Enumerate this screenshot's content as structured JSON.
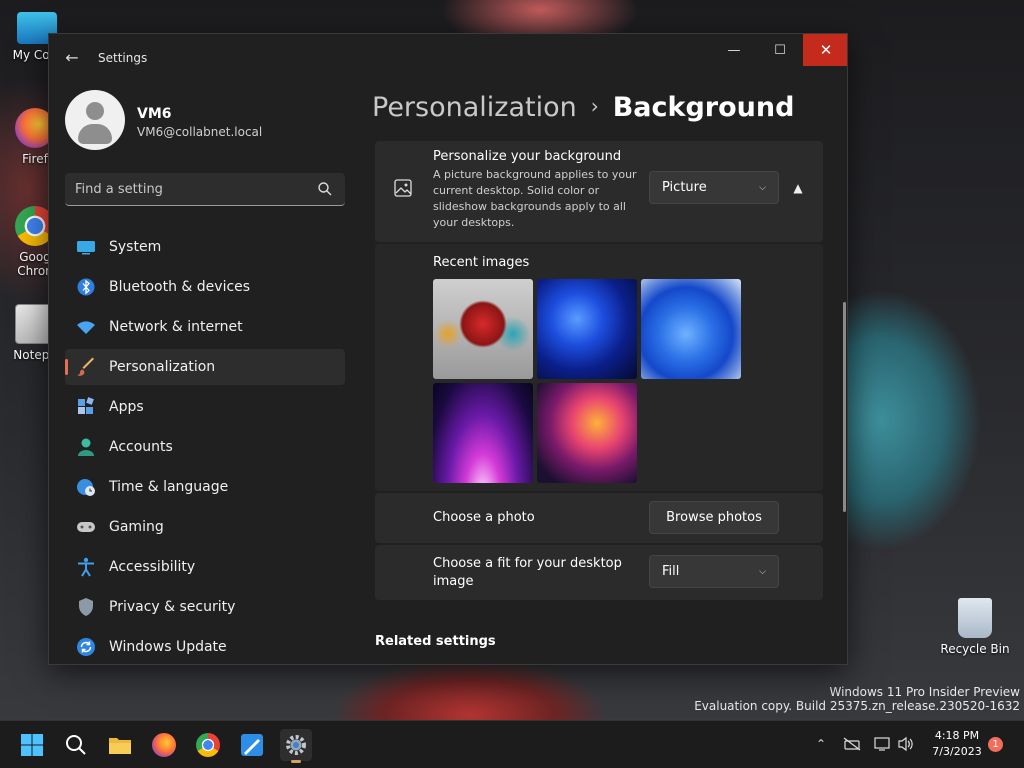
{
  "desktop": {
    "icons": [
      {
        "label": "My Com"
      },
      {
        "label": "Firef"
      },
      {
        "label": "Goog Chron"
      },
      {
        "label": "Notepa"
      },
      {
        "label": "Recycle Bin"
      }
    ],
    "watermark_line1": "Windows 11 Pro Insider Preview",
    "watermark_line2": "Evaluation copy. Build 25375.zn_release.230520-1632"
  },
  "window": {
    "title": "Settings",
    "controls": {
      "minimize": "—",
      "maximize": "☐",
      "close": "✕"
    }
  },
  "user": {
    "name": "VM6",
    "email": "VM6@collabnet.local"
  },
  "search": {
    "placeholder": "Find a setting"
  },
  "nav": [
    {
      "label": "System",
      "icon": "system-icon"
    },
    {
      "label": "Bluetooth & devices",
      "icon": "bluetooth-icon"
    },
    {
      "label": "Network & internet",
      "icon": "network-icon"
    },
    {
      "label": "Personalization",
      "icon": "personalization-icon",
      "active": true
    },
    {
      "label": "Apps",
      "icon": "apps-icon"
    },
    {
      "label": "Accounts",
      "icon": "accounts-icon"
    },
    {
      "label": "Time & language",
      "icon": "time-language-icon"
    },
    {
      "label": "Gaming",
      "icon": "gaming-icon"
    },
    {
      "label": "Accessibility",
      "icon": "accessibility-icon"
    },
    {
      "label": "Privacy & security",
      "icon": "privacy-icon"
    },
    {
      "label": "Windows Update",
      "icon": "windows-update-icon"
    }
  ],
  "breadcrumb": {
    "parent": "Personalization",
    "separator": "›",
    "current": "Background"
  },
  "personalize": {
    "title": "Personalize your background",
    "description": "A picture background applies to your current desktop. Solid color or slideshow backgrounds apply to all your desktops.",
    "dropdown_value": "Picture"
  },
  "recent_images": {
    "title": "Recent images",
    "count": 5
  },
  "choose_photo": {
    "label": "Choose a photo",
    "button": "Browse photos"
  },
  "choose_fit": {
    "label": "Choose a fit for your desktop image",
    "dropdown_value": "Fill"
  },
  "related_settings": {
    "title": "Related settings"
  },
  "taskbar": {
    "apps": [
      "start-icon",
      "search-icon",
      "file-explorer-icon",
      "firefox-icon",
      "chrome-icon",
      "paint-icon",
      "settings-icon"
    ],
    "clock_time": "4:18 PM",
    "clock_date": "7/3/2023",
    "notification_count": "1"
  },
  "colors": {
    "accent": "#e3714f",
    "close_hover": "#c42b1c",
    "window_bg": "#202020",
    "card_bg": "#2b2b2b"
  }
}
